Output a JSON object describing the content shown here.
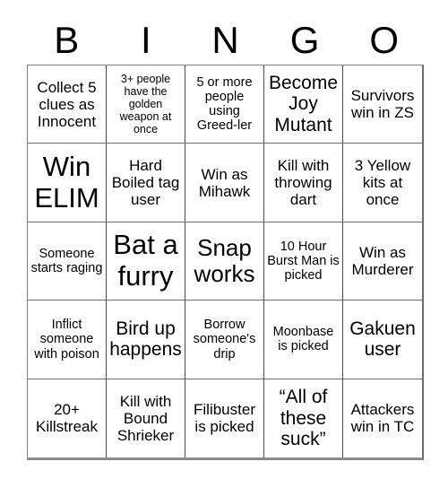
{
  "header": {
    "letters": [
      "B",
      "I",
      "N",
      "G",
      "O"
    ]
  },
  "grid": {
    "rows": 5,
    "columns": 5,
    "border_color": "#4d4d4d",
    "background": "#ffffff",
    "text_color": "#000000"
  },
  "cells": [
    {
      "text": "Collect 5 clues as Innocent",
      "size": "fs-m"
    },
    {
      "text": "3+ people have the golden weapon at once",
      "size": "fs-xs"
    },
    {
      "text": "5 or more people using Greed-ler",
      "size": "fs-s"
    },
    {
      "text": "Become Joy Mutant",
      "size": "fs-l"
    },
    {
      "text": "Survivors win in ZS",
      "size": "fs-m"
    },
    {
      "text": "Win ELIM",
      "size": "fs-xxl"
    },
    {
      "text": "Hard Boiled tag user",
      "size": "fs-m"
    },
    {
      "text": "Win as Mihawk",
      "size": "fs-m"
    },
    {
      "text": "Kill with throwing dart",
      "size": "fs-m"
    },
    {
      "text": "3 Yellow kits at once",
      "size": "fs-m"
    },
    {
      "text": "Someone starts raging",
      "size": "fs-s"
    },
    {
      "text": "Bat a furry",
      "size": "fs-xxl"
    },
    {
      "text": "Snap works",
      "size": "fs-xl"
    },
    {
      "text": "10 Hour Burst Man is picked",
      "size": "fs-s"
    },
    {
      "text": "Win as Murderer",
      "size": "fs-m"
    },
    {
      "text": "Inflict someone with poison",
      "size": "fs-s"
    },
    {
      "text": "Bird up happens",
      "size": "fs-l"
    },
    {
      "text": "Borrow someone's drip",
      "size": "fs-s"
    },
    {
      "text": "Moonbase is picked",
      "size": "fs-s"
    },
    {
      "text": "Gakuen user",
      "size": "fs-l"
    },
    {
      "text": "20+ Killstreak",
      "size": "fs-m"
    },
    {
      "text": "Kill with Bound Shrieker",
      "size": "fs-m"
    },
    {
      "text": "Filibuster is picked",
      "size": "fs-m"
    },
    {
      "text": "“All of these suck”",
      "size": "fs-l"
    },
    {
      "text": "Attackers win in TC",
      "size": "fs-m"
    }
  ]
}
